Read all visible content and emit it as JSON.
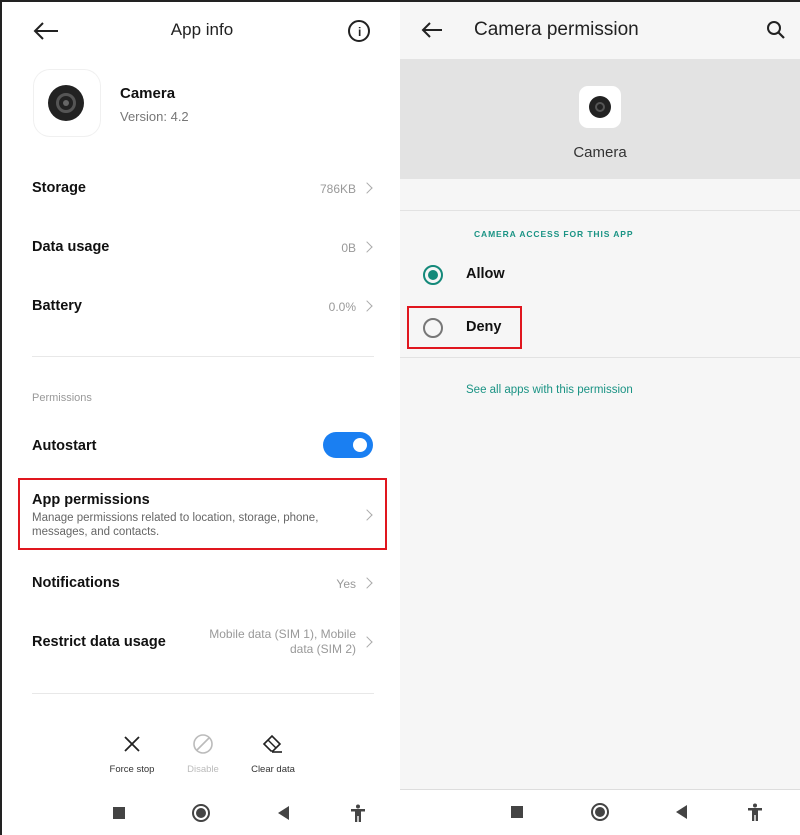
{
  "left": {
    "header": {
      "title": "App info",
      "back_icon": "arrow-left-icon",
      "info_icon": "info-icon",
      "info_glyph": "i"
    },
    "app": {
      "name": "Camera",
      "version": "Version: 4.2",
      "icon": "camera-lens-icon"
    },
    "rows": [
      {
        "label": "Storage",
        "value": "786KB"
      },
      {
        "label": "Data usage",
        "value": "0B"
      },
      {
        "label": "Battery",
        "value": "0.0%"
      }
    ],
    "permissions_section": "Permissions",
    "autostart": {
      "label": "Autostart",
      "enabled": true
    },
    "app_permissions": {
      "label": "App permissions",
      "description": "Manage permissions related to location, storage, phone, messages, and contacts."
    },
    "notifications": {
      "label": "Notifications",
      "value": "Yes"
    },
    "restrict_data": {
      "label": "Restrict data usage",
      "value_line1": "Mobile data (SIM 1), Mobile",
      "value_line2": "data (SIM 2)"
    },
    "actions": [
      {
        "label": "Force stop",
        "icon": "close-icon",
        "enabled": true
      },
      {
        "label": "Disable",
        "icon": "block-icon",
        "enabled": false
      },
      {
        "label": "Clear data",
        "icon": "eraser-icon",
        "enabled": true
      }
    ]
  },
  "right": {
    "header": {
      "title": "Camera permission",
      "back_icon": "arrow-left-icon",
      "search_icon": "search-icon"
    },
    "app": {
      "name": "Camera"
    },
    "section_title": "CAMERA ACCESS FOR THIS APP",
    "options": [
      {
        "label": "Allow",
        "selected": true
      },
      {
        "label": "Deny",
        "selected": false
      }
    ],
    "see_all": "See all apps with this permission"
  },
  "navbar": {
    "items": [
      "recents",
      "home",
      "back",
      "accessibility"
    ]
  },
  "colors": {
    "accent_teal": "#14897a",
    "toggle_blue": "#1a7ff2",
    "highlight_red": "#e0161e"
  }
}
